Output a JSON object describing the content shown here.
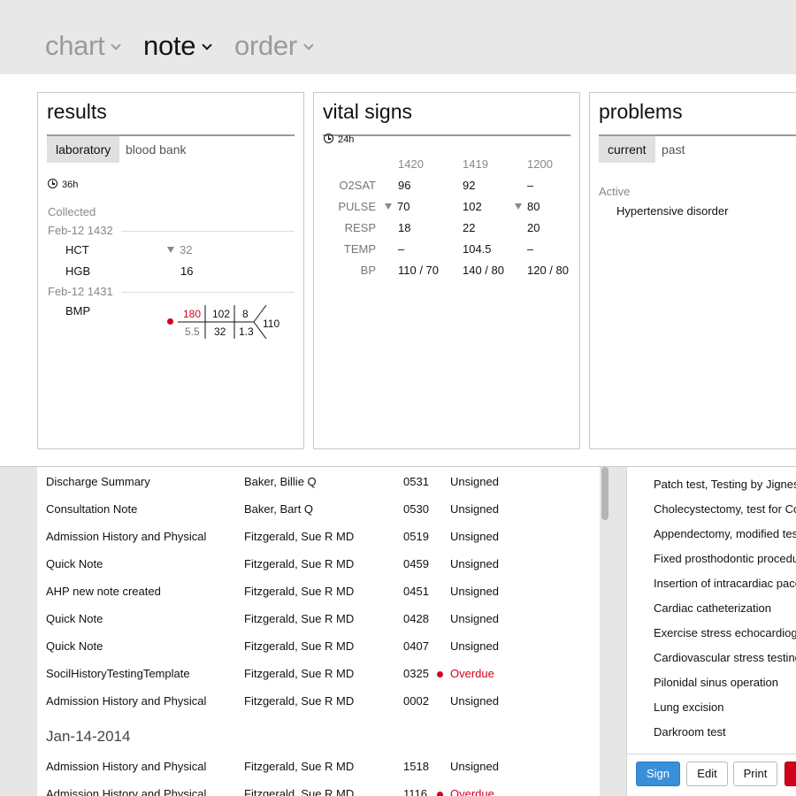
{
  "nav": {
    "chart": "chart",
    "note": "note",
    "order": "order"
  },
  "results": {
    "title": "results",
    "tabs": [
      "laboratory",
      "blood bank"
    ],
    "range": "36h",
    "collected": "Collected",
    "group1_date": "Feb-12 1432",
    "hct_label": "HCT",
    "hct_value": "32",
    "hgb_label": "HGB",
    "hgb_value": "16",
    "group2_date": "Feb-12 1431",
    "bmp_label": "BMP",
    "bmp": {
      "na": "180",
      "cl": "102",
      "bun": "8",
      "k": "5.5",
      "co2": "32",
      "cr": "1.3",
      "glu": "110"
    }
  },
  "vitals": {
    "title": "vital signs",
    "range": "24h",
    "times": [
      "1420",
      "1419",
      "1200"
    ],
    "rows": [
      {
        "label": "O2SAT",
        "values": [
          "96",
          "92",
          "–"
        ]
      },
      {
        "label": "PULSE",
        "values": [
          "70",
          "102",
          "80"
        ]
      },
      {
        "label": "RESP",
        "values": [
          "18",
          "22",
          "20"
        ]
      },
      {
        "label": "TEMP",
        "values": [
          "–",
          "104.5",
          "–"
        ]
      },
      {
        "label": "BP",
        "values": [
          "110 / 70",
          "140 / 80",
          "120 / 80"
        ]
      }
    ]
  },
  "problems": {
    "title": "problems",
    "tabs": [
      "current",
      "past"
    ],
    "status": "Active",
    "items": [
      "Hypertensive disorder"
    ]
  },
  "notes": {
    "rows": [
      {
        "title": "Discharge Summary",
        "author": "Baker, Billie Q",
        "time": "0531",
        "status": "Unsigned"
      },
      {
        "title": "Consultation Note",
        "author": "Baker, Bart Q",
        "time": "0530",
        "status": "Unsigned"
      },
      {
        "title": "Admission History and Physical",
        "author": "Fitzgerald, Sue R MD",
        "time": "0519",
        "status": "Unsigned"
      },
      {
        "title": "Quick Note",
        "author": "Fitzgerald, Sue R MD",
        "time": "0459",
        "status": "Unsigned"
      },
      {
        "title": "AHP new note created",
        "author": "Fitzgerald, Sue R MD",
        "time": "0451",
        "status": "Unsigned"
      },
      {
        "title": "Quick Note",
        "author": "Fitzgerald, Sue R MD",
        "time": "0428",
        "status": "Unsigned"
      },
      {
        "title": "Quick Note",
        "author": "Fitzgerald, Sue R MD",
        "time": "0407",
        "status": "Unsigned"
      },
      {
        "title": "SocilHistoryTestingTemplate",
        "author": "Fitzgerald, Sue R MD",
        "time": "0325",
        "status": "Overdue"
      },
      {
        "title": "Admission History and Physical",
        "author": "Fitzgerald, Sue R MD",
        "time": "0002",
        "status": "Unsigned"
      }
    ],
    "date_header": "Jan-14-2014",
    "rows2": [
      {
        "title": "Admission History and Physical",
        "author": "Fitzgerald, Sue R MD",
        "time": "1518",
        "status": "Unsigned"
      },
      {
        "title": "Admission History and Physical",
        "author": "Fitzgerald, Sue R MD",
        "time": "1116",
        "status": "Overdue"
      }
    ]
  },
  "procedures": [
    "Patch test, Testing by Jignesh",
    "Cholecystectomy, test for Code",
    "Appendectomy, modified test",
    "Fixed prosthodontic procedure",
    "Insertion of intracardiac pacemaker",
    "Cardiac catheterization",
    "Exercise stress echocardiography",
    "Cardiovascular stress testing",
    "Pilonidal sinus operation",
    "Lung excision",
    "Darkroom test"
  ],
  "actions": {
    "sign": "Sign",
    "edit": "Edit",
    "print": "Print"
  },
  "colors": {
    "primary": "#3a8fd9",
    "alert": "#d0021b"
  }
}
